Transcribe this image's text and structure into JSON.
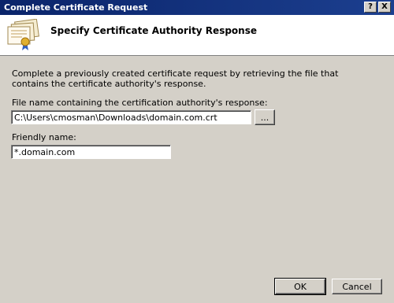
{
  "window": {
    "title": "Complete Certificate Request",
    "help_label": "?",
    "close_label": "X"
  },
  "header": {
    "title": "Specify Certificate Authority Response",
    "icon": "certificate-icon"
  },
  "description": "Complete a previously created certificate request by retrieving the file that contains the certificate authority's response.",
  "file_field": {
    "label": "File name containing the certification authority's response:",
    "value": "C:\\Users\\cmosman\\Downloads\\domain.com.crt",
    "browse_label": "..."
  },
  "friendly_field": {
    "label": "Friendly name:",
    "value": "*.domain.com"
  },
  "buttons": {
    "ok_label": "OK",
    "cancel_label": "Cancel"
  }
}
